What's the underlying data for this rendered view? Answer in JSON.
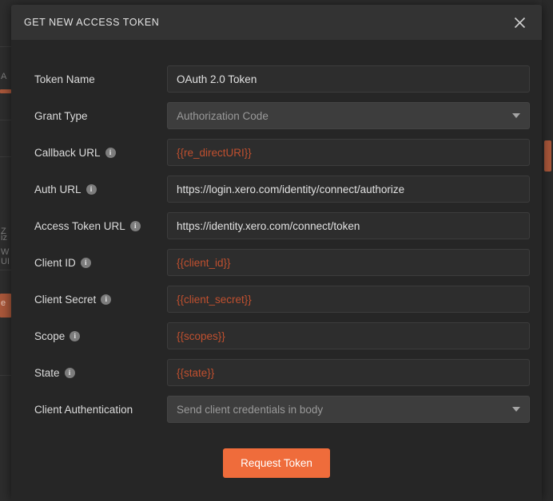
{
  "modal": {
    "title": "GET NEW ACCESS TOKEN",
    "close_icon": "close-icon"
  },
  "form": {
    "rows": [
      {
        "label": "Token Name",
        "info": false,
        "type": "text",
        "value": "OAuth 2.0 Token",
        "variable": false
      },
      {
        "label": "Grant Type",
        "info": false,
        "type": "select",
        "value": "Authorization Code",
        "variable": false
      },
      {
        "label": "Callback URL",
        "info": true,
        "type": "text",
        "value": "{{re_directURI}}",
        "variable": true
      },
      {
        "label": "Auth URL",
        "info": true,
        "type": "text",
        "value": "https://login.xero.com/identity/connect/authorize",
        "variable": false
      },
      {
        "label": "Access Token URL",
        "info": true,
        "type": "text",
        "value": "https://identity.xero.com/connect/token",
        "variable": false
      },
      {
        "label": "Client ID",
        "info": true,
        "type": "text",
        "value": "{{client_id}}",
        "variable": true
      },
      {
        "label": "Client Secret",
        "info": true,
        "type": "text",
        "value": "{{client_secret}}",
        "variable": true
      },
      {
        "label": "Scope",
        "info": true,
        "type": "text",
        "value": "{{scopes}}",
        "variable": true
      },
      {
        "label": "State",
        "info": true,
        "type": "text",
        "value": "{{state}}",
        "variable": true
      },
      {
        "label": "Client Authentication",
        "info": false,
        "type": "select",
        "value": "Send client credentials in body",
        "variable": false
      }
    ],
    "submit_label": "Request Token"
  },
  "colors": {
    "accent": "#ef6c3b",
    "variable_text": "#c0502f",
    "modal_body": "#262626",
    "modal_header": "#333333",
    "field_bg": "#2d2d2d",
    "select_bg": "#3d3d3d"
  },
  "background": {
    "fragments": [
      "A",
      "Z",
      "W",
      "iz",
      "UI",
      "e"
    ]
  }
}
